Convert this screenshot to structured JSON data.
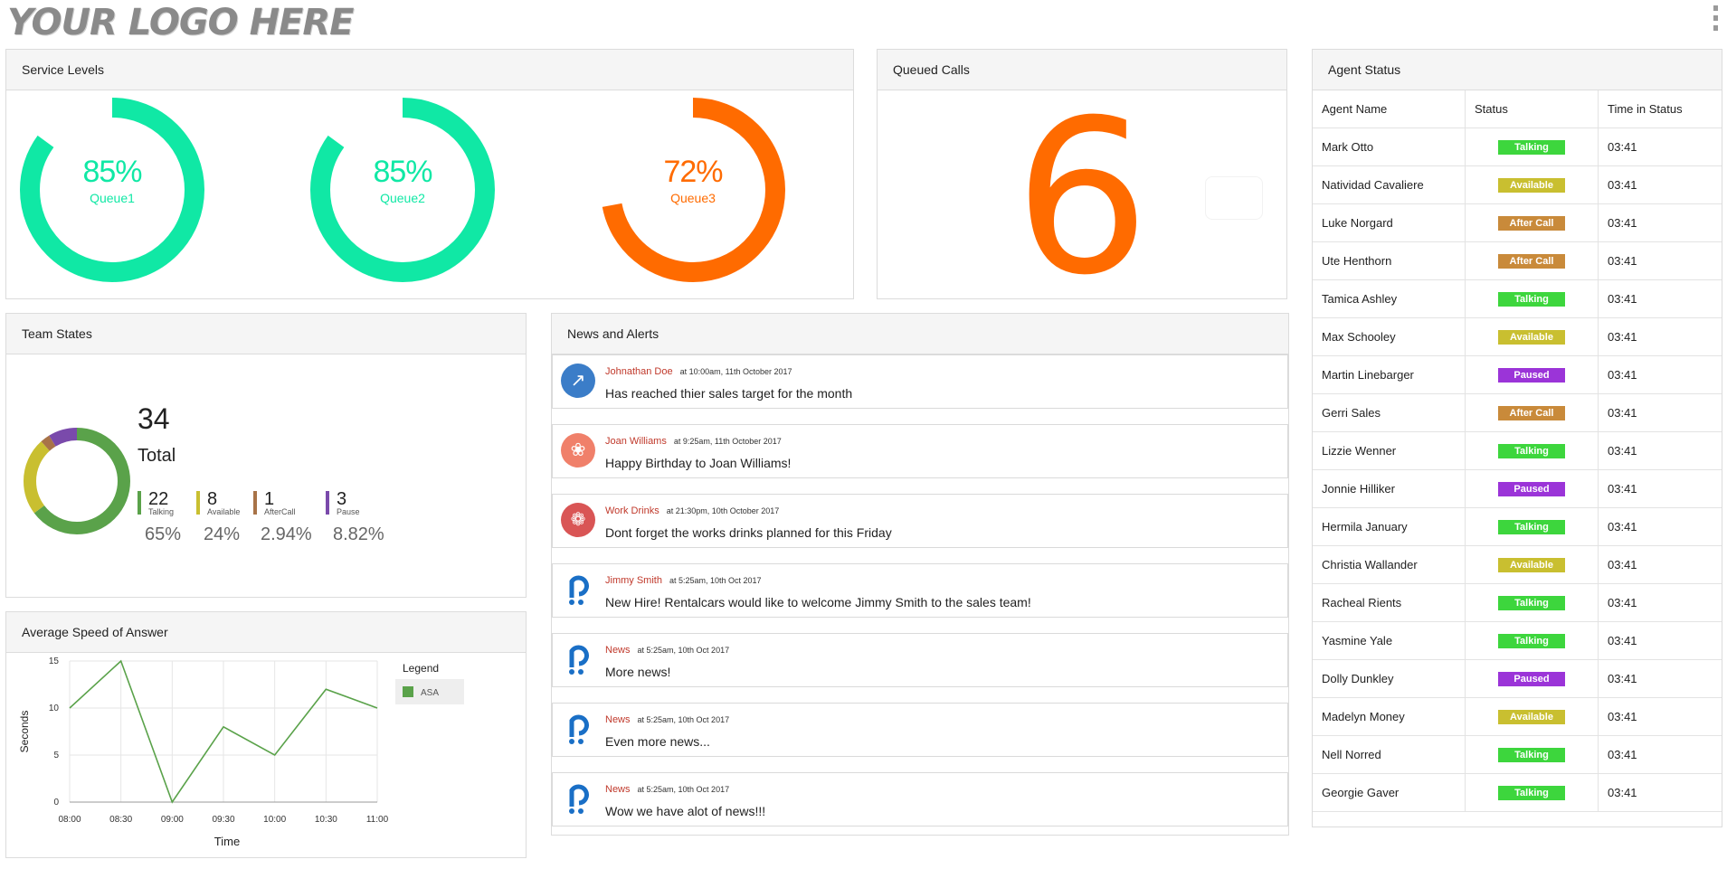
{
  "logo": "YOUR LOGO HERE",
  "service_levels": {
    "title": "Service Levels",
    "gauges": [
      {
        "percent": 85,
        "label": "85%",
        "queue": "Queue1",
        "color": "#10e8a5"
      },
      {
        "percent": 85,
        "label": "85%",
        "queue": "Queue2",
        "color": "#10e8a5"
      },
      {
        "percent": 72,
        "label": "72%",
        "queue": "Queue3",
        "color": "#ff6b00"
      }
    ]
  },
  "queued_calls": {
    "title": "Queued Calls",
    "value": "6"
  },
  "agent_status": {
    "title": "Agent Status",
    "columns": [
      "Agent Name",
      "Status",
      "Time in Status"
    ],
    "rows": [
      {
        "name": "Mark Otto",
        "status": "Talking",
        "time": "03:41"
      },
      {
        "name": "Natividad Cavaliere",
        "status": "Available",
        "time": "03:41"
      },
      {
        "name": "Luke Norgard",
        "status": "After Call",
        "time": "03:41"
      },
      {
        "name": "Ute Henthorn",
        "status": "After Call",
        "time": "03:41"
      },
      {
        "name": "Tamica Ashley",
        "status": "Talking",
        "time": "03:41"
      },
      {
        "name": "Max Schooley",
        "status": "Available",
        "time": "03:41"
      },
      {
        "name": "Martin Linebarger",
        "status": "Paused",
        "time": "03:41"
      },
      {
        "name": "Gerri Sales",
        "status": "After Call",
        "time": "03:41"
      },
      {
        "name": "Lizzie Wenner",
        "status": "Talking",
        "time": "03:41"
      },
      {
        "name": "Jonnie Hilliker",
        "status": "Paused",
        "time": "03:41"
      },
      {
        "name": "Hermila January",
        "status": "Talking",
        "time": "03:41"
      },
      {
        "name": "Christia Wallander",
        "status": "Available",
        "time": "03:41"
      },
      {
        "name": "Racheal Rients",
        "status": "Talking",
        "time": "03:41"
      },
      {
        "name": "Yasmine Yale",
        "status": "Talking",
        "time": "03:41"
      },
      {
        "name": "Dolly Dunkley",
        "status": "Paused",
        "time": "03:41"
      },
      {
        "name": "Madelyn Money",
        "status": "Available",
        "time": "03:41"
      },
      {
        "name": "Nell Norred",
        "status": "Talking",
        "time": "03:41"
      },
      {
        "name": "Georgie Gaver",
        "status": "Talking",
        "time": "03:41"
      }
    ],
    "status_colors": {
      "Talking": "#3dd63d",
      "Available": "#c9bf30",
      "After Call": "#c98a3a",
      "Paused": "#9b34d8"
    }
  },
  "team_states": {
    "title": "Team States",
    "total": "34",
    "total_label": "Total",
    "states": [
      {
        "count": "22",
        "label": "Talking",
        "pct": "65%",
        "value": 22,
        "color": "#5aa24a"
      },
      {
        "count": "8",
        "label": "Available",
        "pct": "24%",
        "value": 8,
        "color": "#c9bf30"
      },
      {
        "count": "1",
        "label": "AfterCall",
        "pct": "2.94%",
        "value": 1,
        "color": "#a87348"
      },
      {
        "count": "3",
        "label": "Pause",
        "pct": "8.82%",
        "value": 3,
        "color": "#7a4aab"
      }
    ]
  },
  "asa": {
    "title": "Average Speed of Answer"
  },
  "chart_data": {
    "type": "line",
    "x": [
      "08:00",
      "08:30",
      "09:00",
      "09:30",
      "10:00",
      "10:30",
      "11:00"
    ],
    "series": [
      {
        "name": "ASA",
        "values": [
          10,
          15,
          0,
          8,
          5,
          12,
          10
        ],
        "color": "#5aa24a"
      }
    ],
    "yticks": [
      "0",
      "5",
      "10",
      "15"
    ],
    "ylim": [
      0,
      15
    ],
    "xlabel": "Time",
    "ylabel": "Seconds",
    "legend_title": "Legend",
    "grid": true
  },
  "news": {
    "title": "News and Alerts",
    "items": [
      {
        "author": "Johnathan Doe",
        "when": "at 10:00am, 11th October 2017",
        "msg": "Has reached thier sales target for the month",
        "icon": "chart-icon",
        "color": "#3b7dc8"
      },
      {
        "author": "Joan Williams",
        "when": "at 9:25am, 11th October 2017",
        "msg": "Happy Birthday to Joan Williams!",
        "icon": "cake-icon",
        "color": "#f0806a"
      },
      {
        "author": "Work Drinks",
        "when": "at 21:30pm, 10th October 2017",
        "msg": "Dont forget the works drinks planned for this Friday",
        "icon": "glasses-icon",
        "color": "#d95555"
      },
      {
        "author": "Jimmy Smith",
        "when": "at 5:25am, 10th Oct 2017",
        "msg": "New Hire! Rentalcars would like to welcome Jimmy Smith to the sales team!",
        "icon": "rentalcars-logo-icon",
        "color": "#1a6fc6"
      },
      {
        "author": "News",
        "when": "at 5:25am, 10th Oct 2017",
        "msg": "More news!",
        "icon": "rentalcars-logo-icon",
        "color": "#1a6fc6"
      },
      {
        "author": "News",
        "when": "at 5:25am, 10th Oct 2017",
        "msg": "Even more news...",
        "icon": "rentalcars-logo-icon",
        "color": "#1a6fc6"
      },
      {
        "author": "News",
        "when": "at 5:25am, 10th Oct 2017",
        "msg": "Wow we have alot of news!!!",
        "icon": "rentalcars-logo-icon",
        "color": "#1a6fc6"
      }
    ]
  }
}
